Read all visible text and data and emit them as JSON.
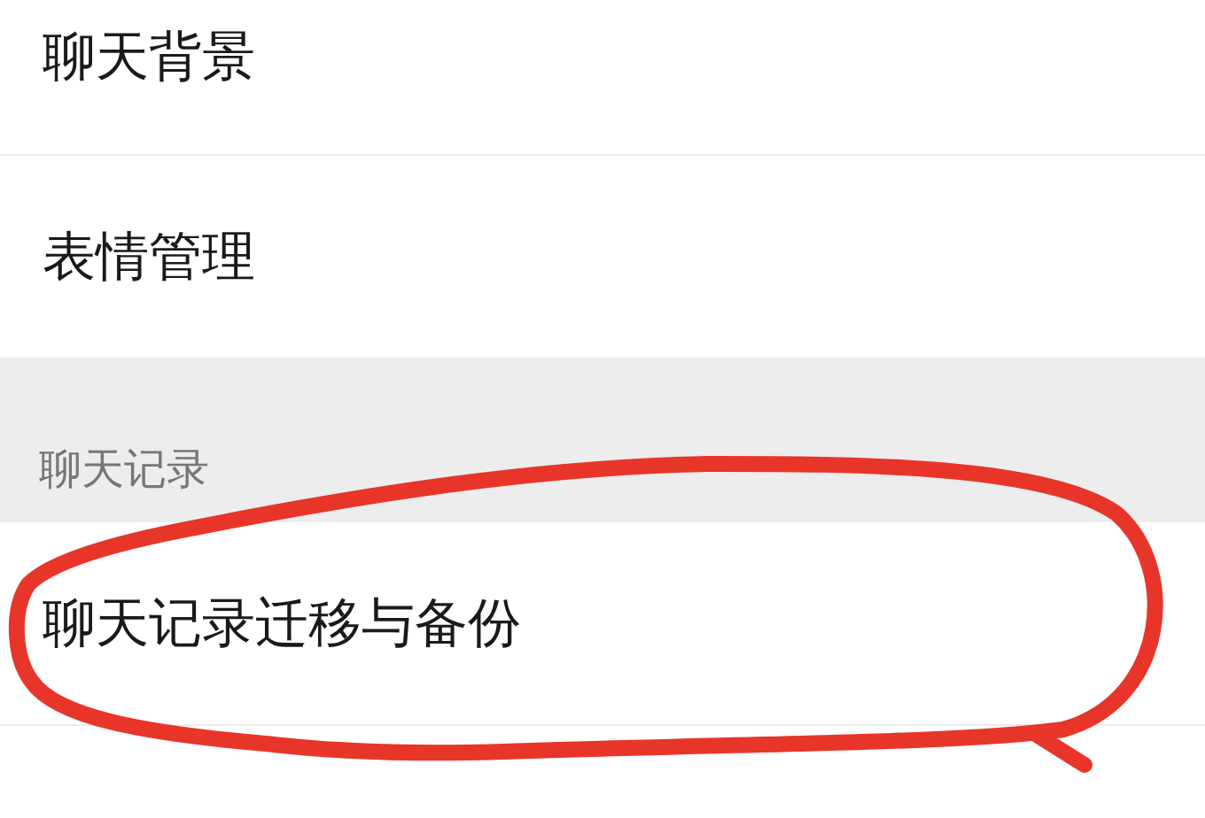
{
  "settings_items": [
    {
      "label": "聊天背景"
    },
    {
      "label": "表情管理"
    }
  ],
  "section": {
    "title": "聊天记录",
    "items": [
      {
        "label": "聊天记录迁移与备份",
        "highlighted": true
      }
    ]
  }
}
